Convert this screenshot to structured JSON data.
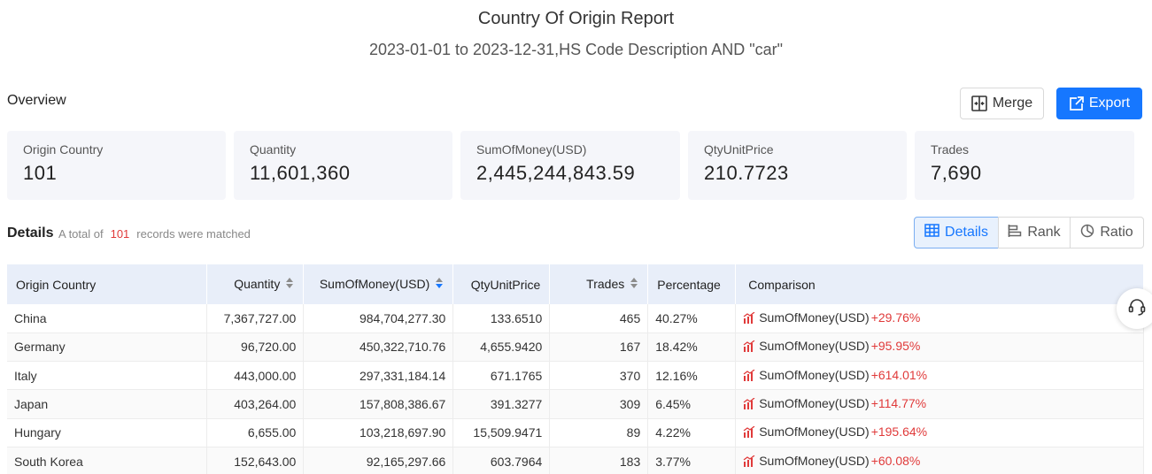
{
  "header": {
    "title": "Country Of Origin Report",
    "subtitle": "2023-01-01 to 2023-12-31,HS Code Description AND \"car\""
  },
  "overview": {
    "label": "Overview",
    "merge_label": "Merge",
    "export_label": "Export",
    "cards": [
      {
        "label": "Origin Country",
        "value": "101"
      },
      {
        "label": "Quantity",
        "value": "11,601,360"
      },
      {
        "label": "SumOfMoney(USD)",
        "value": "2,445,244,843.59"
      },
      {
        "label": "QtyUnitPrice",
        "value": "210.7723"
      },
      {
        "label": "Trades",
        "value": "7,690"
      }
    ]
  },
  "details": {
    "label": "Details",
    "total_prefix": "A total of",
    "total_count": "101",
    "total_suffix": "records were matched",
    "views": {
      "details": "Details",
      "rank": "Rank",
      "ratio": "Ratio"
    },
    "active_view": "details"
  },
  "table": {
    "columns": [
      "Origin Country",
      "Quantity",
      "SumOfMoney(USD)",
      "QtyUnitPrice",
      "Trades",
      "Percentage",
      "Comparison"
    ],
    "sorted_column": "SumOfMoney(USD)",
    "sort_direction": "descending",
    "rows": [
      {
        "country": "China",
        "quantity": "7,367,727.00",
        "sum": "984,704,277.30",
        "unit_price": "133.6510",
        "trades": "465",
        "percentage": "40.27%",
        "cmp_label": "SumOfMoney(USD)",
        "cmp_value": "+29.76%"
      },
      {
        "country": "Germany",
        "quantity": "96,720.00",
        "sum": "450,322,710.76",
        "unit_price": "4,655.9420",
        "trades": "167",
        "percentage": "18.42%",
        "cmp_label": "SumOfMoney(USD)",
        "cmp_value": "+95.95%"
      },
      {
        "country": "Italy",
        "quantity": "443,000.00",
        "sum": "297,331,184.14",
        "unit_price": "671.1765",
        "trades": "370",
        "percentage": "12.16%",
        "cmp_label": "SumOfMoney(USD)",
        "cmp_value": "+614.01%"
      },
      {
        "country": "Japan",
        "quantity": "403,264.00",
        "sum": "157,808,386.67",
        "unit_price": "391.3277",
        "trades": "309",
        "percentage": "6.45%",
        "cmp_label": "SumOfMoney(USD)",
        "cmp_value": "+114.77%"
      },
      {
        "country": "Hungary",
        "quantity": "6,655.00",
        "sum": "103,218,697.90",
        "unit_price": "15,509.9471",
        "trades": "89",
        "percentage": "4.22%",
        "cmp_label": "SumOfMoney(USD)",
        "cmp_value": "+195.64%"
      },
      {
        "country": "South Korea",
        "quantity": "152,643.00",
        "sum": "92,165,297.66",
        "unit_price": "603.7964",
        "trades": "183",
        "percentage": "3.77%",
        "cmp_label": "SumOfMoney(USD)",
        "cmp_value": "+60.08%"
      }
    ]
  },
  "colors": {
    "accent": "#1677ff",
    "increase": "#e03a3a",
    "card_bg": "#f5f6fa",
    "header_bg": "#e8eef9"
  },
  "icons": {
    "merge": "merge-icon",
    "export": "export-icon",
    "details": "table-icon",
    "rank": "bar-rank-icon",
    "ratio": "pie-chart-icon",
    "trend": "trend-up-icon",
    "support": "headset-icon"
  }
}
